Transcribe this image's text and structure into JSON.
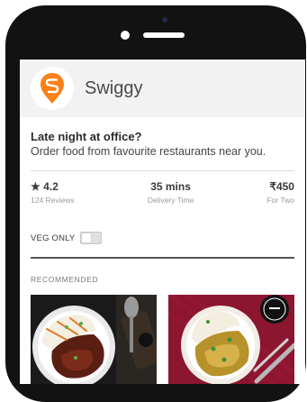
{
  "app": {
    "title": "Swiggy",
    "brand_color": "#FC8019"
  },
  "promo": {
    "headline": "Late night at office?",
    "subline": "Order food from favourite restaurants near you."
  },
  "stats": {
    "rating": {
      "value": "★ 4.2",
      "label": "124 Reviews"
    },
    "delivery": {
      "value": "35 mins",
      "label": "Delivery Time"
    },
    "price": {
      "value": "₹450",
      "label": "For Two"
    }
  },
  "filter": {
    "veg_only_label": "VEG ONLY",
    "veg_only_on": false
  },
  "recommended": {
    "section_label": "RECOMMENDED"
  }
}
